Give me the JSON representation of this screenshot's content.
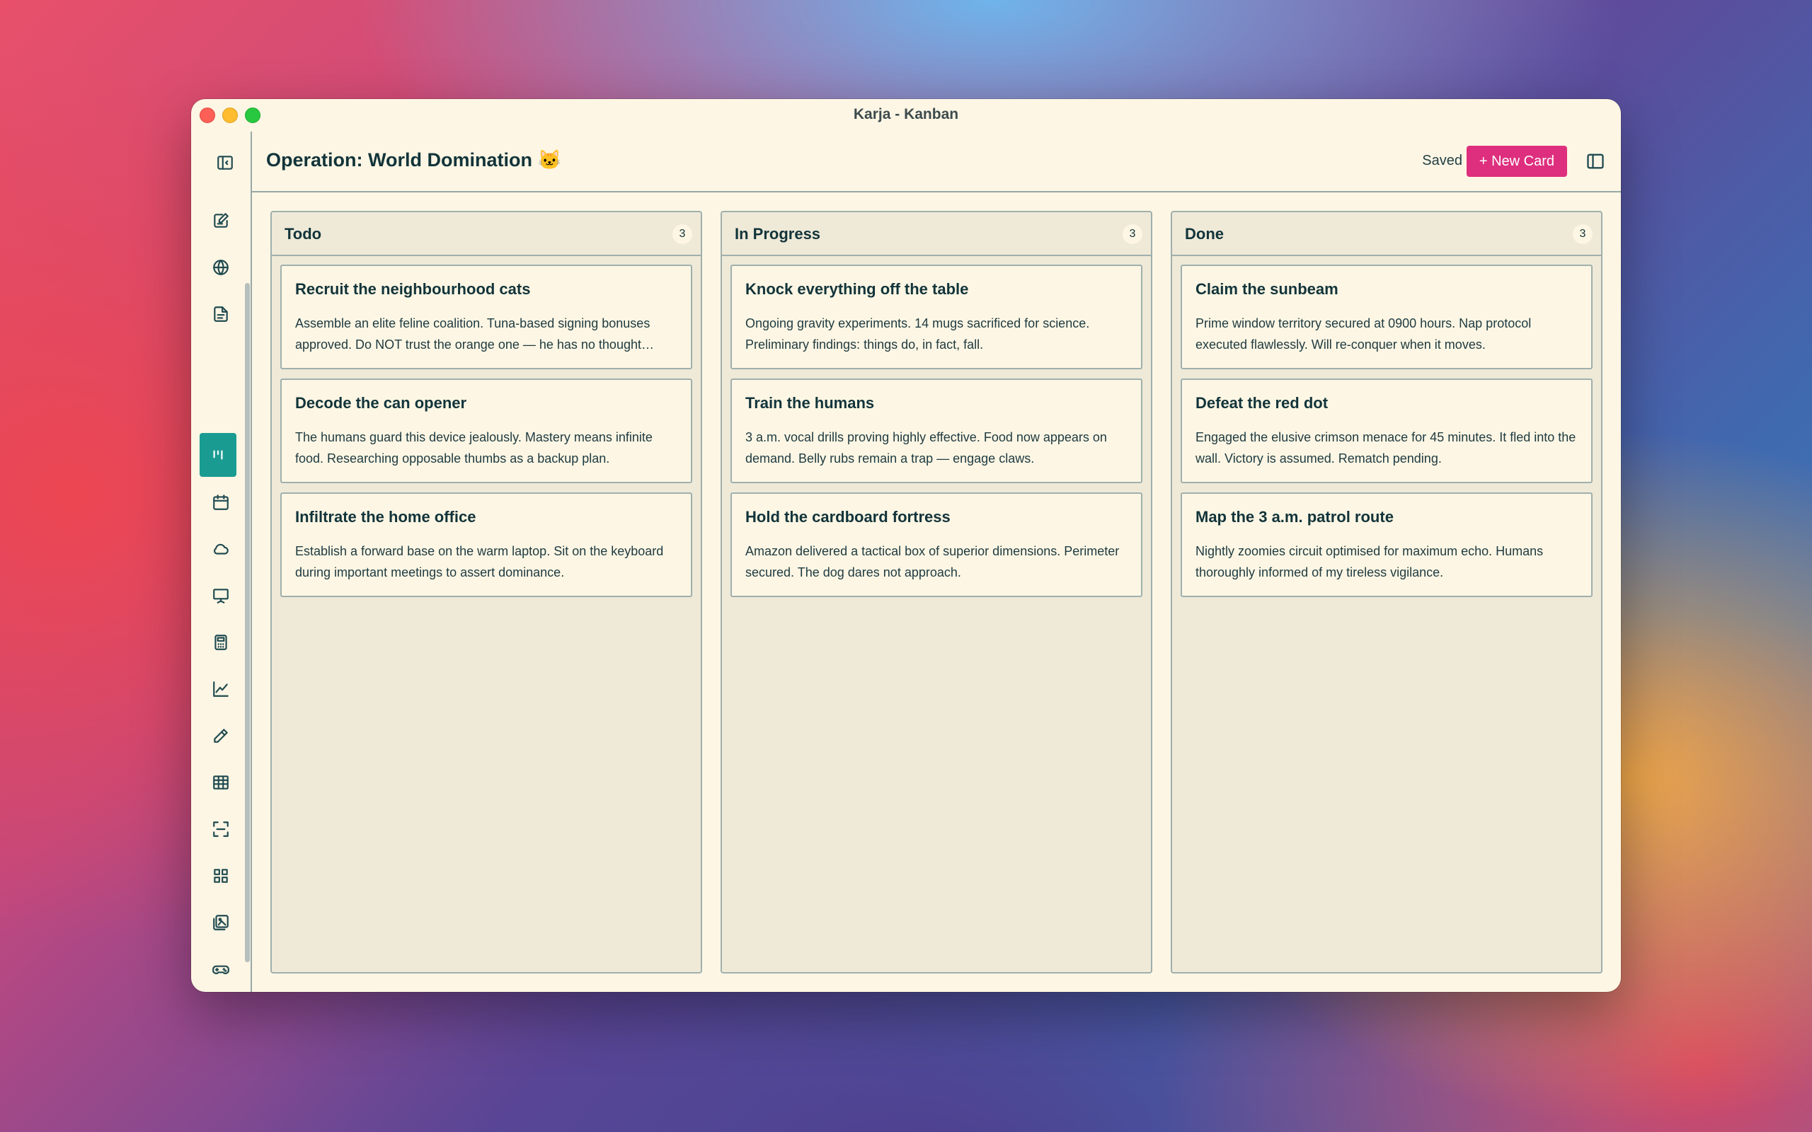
{
  "window": {
    "title": "Karja - Kanban"
  },
  "sidebar": {
    "icons": [
      "sidebar-toggle-icon",
      "notes-icon",
      "globe-icon",
      "document-icon",
      "kanban-icon",
      "calendar-icon",
      "cloud-icon",
      "presentation-icon",
      "calculator-icon",
      "chart-icon",
      "pencil-icon",
      "table-icon",
      "scan-icon",
      "grid-icon",
      "gallery-icon",
      "gamepad-icon",
      "brain-icon",
      "settings-icon"
    ],
    "active": "kanban-icon"
  },
  "header": {
    "board_title": "Operation: World Domination 🐱",
    "saved_label": "Saved",
    "new_card_label": "+ New Card"
  },
  "colors": {
    "accent": "#1a9b92",
    "new_card": "#de2f7e",
    "background": "#fdf6e4"
  },
  "columns": [
    {
      "name": "Todo",
      "count": "3",
      "cards": [
        {
          "title": "Recruit the neighbourhood cats",
          "body": "Assemble an elite feline coalition. Tuna-based signing bonuses approved. Do NOT trust the orange one — he has no thought…"
        },
        {
          "title": "Decode the can opener",
          "body": "The humans guard this device jealously. Mastery means infinite food. Researching opposable thumbs as a backup plan."
        },
        {
          "title": "Infiltrate the home office",
          "body": "Establish a forward base on the warm laptop. Sit on the keyboard during important meetings to assert dominance."
        }
      ]
    },
    {
      "name": "In Progress",
      "count": "3",
      "cards": [
        {
          "title": "Knock everything off the table",
          "body": "Ongoing gravity experiments. 14 mugs sacrificed for science. Preliminary findings: things do, in fact, fall."
        },
        {
          "title": "Train the humans",
          "body": "3 a.m. vocal drills proving highly effective. Food now appears on demand. Belly rubs remain a trap — engage claws."
        },
        {
          "title": "Hold the cardboard fortress",
          "body": "Amazon delivered a tactical box of superior dimensions. Perimeter secured. The dog dares not approach."
        }
      ]
    },
    {
      "name": "Done",
      "count": "3",
      "cards": [
        {
          "title": "Claim the sunbeam",
          "body": "Prime window territory secured at 0900 hours. Nap protocol executed flawlessly. Will re-conquer when it moves."
        },
        {
          "title": "Defeat the red dot",
          "body": "Engaged the elusive crimson menace for 45 minutes. It fled into the wall. Victory is assumed. Rematch pending."
        },
        {
          "title": "Map the 3 a.m. patrol route",
          "body": "Nightly zoomies circuit optimised for maximum echo. Humans thoroughly informed of my tireless vigilance."
        }
      ]
    }
  ]
}
